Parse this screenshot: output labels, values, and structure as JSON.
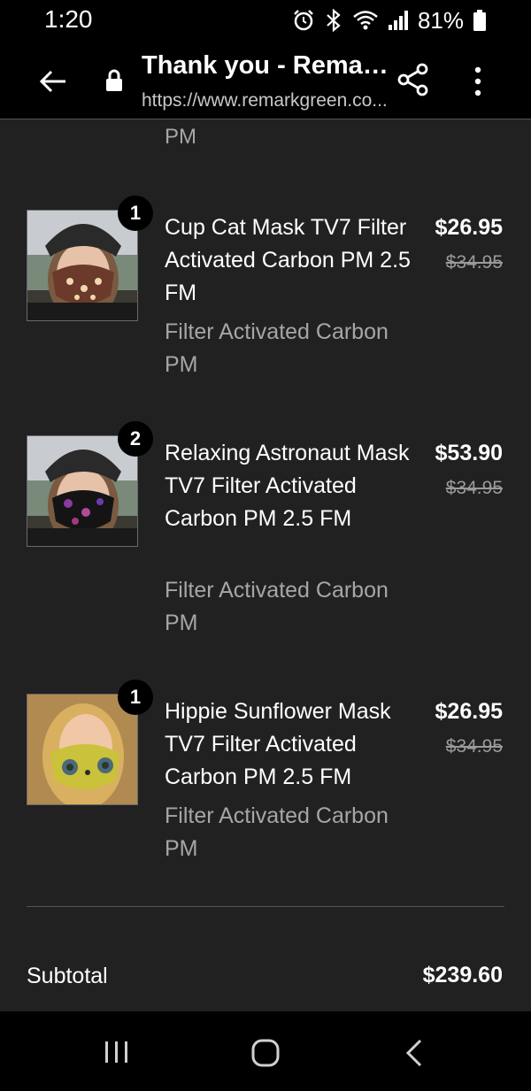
{
  "status_bar": {
    "time": "1:20",
    "battery_percent": "81%",
    "icons": [
      "alarm-icon",
      "bluetooth-icon",
      "wifi-icon",
      "signal-icon",
      "battery-icon"
    ]
  },
  "app_bar": {
    "title": "Thank you - Remark...",
    "url": "https://www.remarkgreen.co...",
    "icons": [
      "back-arrow-icon",
      "lock-icon",
      "share-icon",
      "more-vert-icon"
    ]
  },
  "partial_variant": "PM",
  "items": [
    {
      "quantity": "1",
      "name": "Cup Cat Mask TV7 Filter Activated Carbon PM 2.5 FM",
      "variant": "Filter Activated Carbon PM",
      "price": "$26.95",
      "compare_price": "$34.95",
      "mask_color": "#6b3a2a"
    },
    {
      "quantity": "2",
      "name": "Relaxing Astronaut Mask TV7 Filter Activated Carbon PM 2.5 FM",
      "variant": "Filter Activated Carbon PM",
      "price": "$53.90",
      "compare_price": "$34.95",
      "mask_color": "#141414"
    },
    {
      "quantity": "1",
      "name": "Hippie Sunflower Mask TV7 Filter Activated Carbon PM 2.5 FM",
      "variant": "Filter Activated Carbon PM",
      "price": "$26.95",
      "compare_price": "$34.95",
      "mask_color": "#c9c23a"
    }
  ],
  "subtotal": {
    "label": "Subtotal",
    "value": "$239.60"
  },
  "nav_bar": {
    "icons": [
      "recents-icon",
      "home-icon",
      "back-icon"
    ]
  },
  "colors": {
    "background": "#212121",
    "bars": "#000000",
    "secondary_text": "#a6a6a6"
  }
}
